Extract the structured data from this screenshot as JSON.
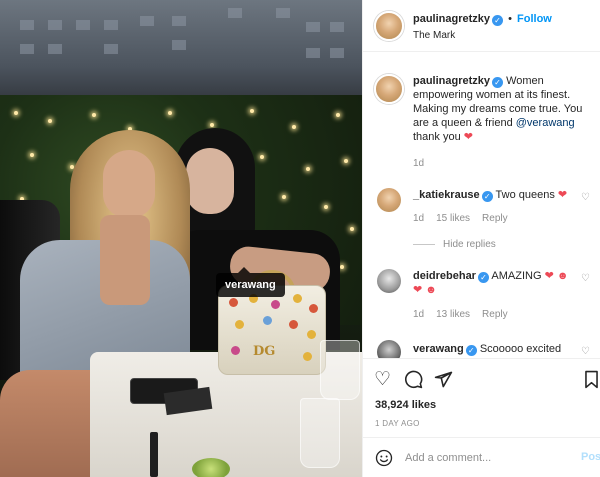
{
  "post": {
    "photo_tag": "verawang",
    "photo_alt": "",
    "photo_logo": "DG"
  },
  "header": {
    "username": "paulinagretzky",
    "verified_mark": "✓",
    "dot": "•",
    "follow_label": "Follow",
    "location": "The Mark"
  },
  "caption": {
    "username": "paulinagretzky",
    "text": "Women empowering women at its finest. Making my dreams come true. You are a queen & friend",
    "mention": "@verawang",
    "text_after": "thank you",
    "emoji": "❤",
    "time": "1d"
  },
  "comments": [
    {
      "username": "_katiekrause",
      "text": "Two queens",
      "emoji": "❤",
      "time": "1d",
      "likes": "15 likes",
      "reply": "Reply"
    },
    {
      "username": "deidrebehar",
      "text": "AMAZING",
      "emoji": "❤ ☻ ❤ ☻",
      "time": "1d",
      "likes": "13 likes",
      "reply": "Reply"
    },
    {
      "username": "verawang",
      "text": "Scooooo excited for",
      "time": "",
      "likes": "",
      "reply": ""
    }
  ],
  "hide_replies": "Hide replies",
  "actions": {
    "likes": "38,924 likes",
    "time_ago": "1 DAY AGO"
  },
  "composer": {
    "placeholder": "Add a comment...",
    "post_label": "Post"
  },
  "colors": {
    "link_blue": "#0095f6",
    "verified_blue": "#3897f0",
    "heart_red": "#ed4956",
    "muted_text": "#8e8e8e"
  }
}
